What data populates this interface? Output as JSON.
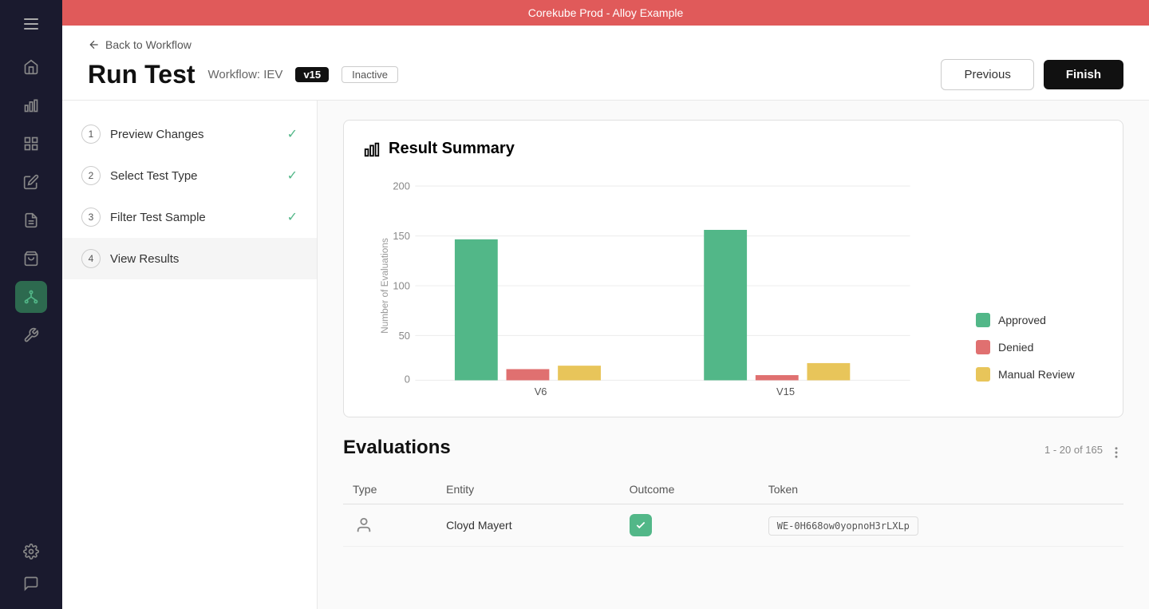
{
  "banner": {
    "text": "Corekube Prod - Alloy Example"
  },
  "header": {
    "back_label": "Back to Workflow",
    "title": "Run Test",
    "workflow_label": "Workflow: IEV",
    "version": "v15",
    "status": "Inactive",
    "btn_previous": "Previous",
    "btn_finish": "Finish"
  },
  "steps": [
    {
      "number": "1",
      "label": "Preview Changes",
      "status": "complete"
    },
    {
      "number": "2",
      "label": "Select Test Type",
      "status": "complete"
    },
    {
      "number": "3",
      "label": "Filter Test Sample",
      "status": "complete"
    },
    {
      "number": "4",
      "label": "View Results",
      "status": "active"
    }
  ],
  "result_summary": {
    "title": "Result Summary",
    "chart": {
      "y_label": "Number of Evaluations",
      "y_values": [
        0,
        50,
        100,
        150,
        200
      ],
      "bars": {
        "v6": {
          "label": "V6",
          "approved": 145,
          "denied": 12,
          "manual_review": 15
        },
        "v15": {
          "label": "V15",
          "approved": 155,
          "denied": 5,
          "manual_review": 18
        }
      },
      "max_value": 200
    },
    "legend": [
      {
        "label": "Approved",
        "color": "#52b788"
      },
      {
        "label": "Denied",
        "color": "#e07070"
      },
      {
        "label": "Manual Review",
        "color": "#e8c55a"
      }
    ]
  },
  "evaluations": {
    "title": "Evaluations",
    "pagination": "1 - 20 of 165",
    "columns": [
      "Type",
      "Entity",
      "Outcome",
      "Token"
    ],
    "rows": [
      {
        "type": "person",
        "entity": "Cloyd Mayert",
        "outcome": "approved",
        "token": "WE-0H668ow0yopnoH3rLXLp"
      }
    ]
  },
  "sidebar": {
    "icons": [
      {
        "name": "home-icon",
        "symbol": "⌂",
        "active": false
      },
      {
        "name": "chart-icon",
        "symbol": "▦",
        "active": false
      },
      {
        "name": "calendar-icon",
        "symbol": "▤",
        "active": false
      },
      {
        "name": "edit-icon",
        "symbol": "✎",
        "active": false
      },
      {
        "name": "document-icon",
        "symbol": "☰",
        "active": false
      },
      {
        "name": "bag-icon",
        "symbol": "⊞",
        "active": false
      },
      {
        "name": "workflow-icon",
        "symbol": "⊛",
        "active": true
      },
      {
        "name": "tools-icon",
        "symbol": "⚙",
        "active": false
      },
      {
        "name": "settings-icon",
        "symbol": "⚙",
        "active": false
      },
      {
        "name": "chat-icon",
        "symbol": "💬",
        "active": false
      }
    ]
  }
}
